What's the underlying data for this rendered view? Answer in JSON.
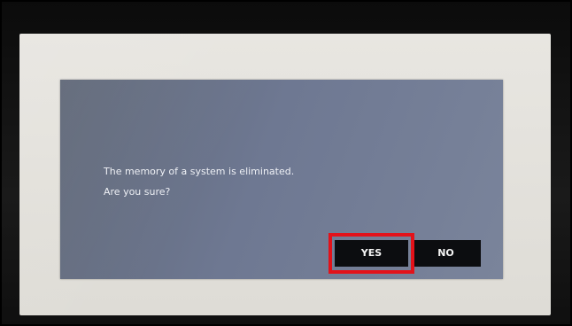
{
  "dialog": {
    "message_line1": "The memory of a system is eliminated.",
    "message_line2": "Are you sure?",
    "yes_label": "YES",
    "no_label": "NO"
  },
  "colors": {
    "dialog_background": "#6e7892",
    "button_background": "#0c0d10",
    "highlight_border": "#e3121a",
    "screen_background": "#e8e6e1"
  }
}
